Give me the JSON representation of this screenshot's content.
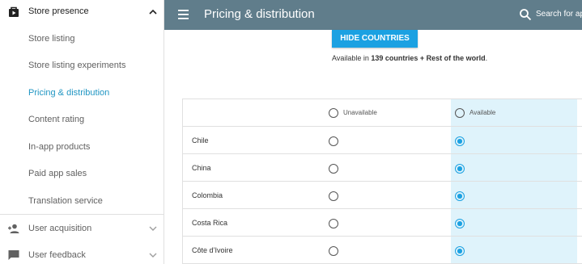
{
  "sidebar": {
    "section_title": "Store presence",
    "items": [
      {
        "label": "Store listing",
        "active": false
      },
      {
        "label": "Store listing experiments",
        "active": false
      },
      {
        "label": "Pricing & distribution",
        "active": true
      },
      {
        "label": "Content rating",
        "active": false
      },
      {
        "label": "In-app products",
        "active": false
      },
      {
        "label": "Paid app sales",
        "active": false
      },
      {
        "label": "Translation service",
        "active": false
      }
    ],
    "groups": [
      {
        "label": "User acquisition",
        "icon": "person-add-icon"
      },
      {
        "label": "User feedback",
        "icon": "chat-icon"
      }
    ]
  },
  "topbar": {
    "title": "Pricing & distribution",
    "search_placeholder": "Search for app"
  },
  "main": {
    "hide_button": "HIDE COUNTRIES",
    "availability": {
      "prefix": "Available in ",
      "count": "139 countries + Rest of the world",
      "suffix": "."
    },
    "table": {
      "columns": [
        "Unavailable",
        "Available"
      ],
      "rows": [
        {
          "country": "Chile",
          "status": "Available"
        },
        {
          "country": "China",
          "status": "Available"
        },
        {
          "country": "Colombia",
          "status": "Available"
        },
        {
          "country": "Costa Rica",
          "status": "Available"
        },
        {
          "country": "Côte d’Ivoire",
          "status": "Available"
        }
      ]
    }
  },
  "colors": {
    "topbar": "#607d8b",
    "accent": "#1ba1e2",
    "active_link": "#2196c3",
    "available_column": "#dff3fb"
  }
}
